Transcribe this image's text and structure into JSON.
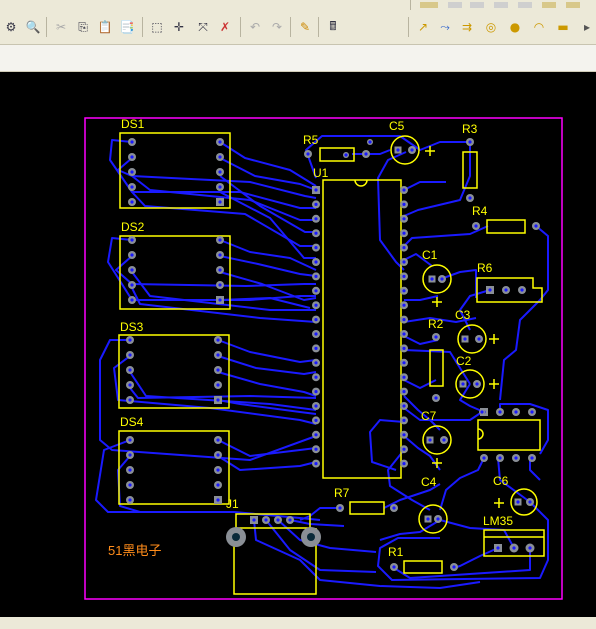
{
  "toolbar": {
    "left_tools": [
      "browse-icon",
      "zoom-icon",
      "cut-icon",
      "copy-icon",
      "paste-icon",
      "paste-special-icon",
      "select-icon",
      "move-icon",
      "cross-select-icon",
      "deselect-icon",
      "undo-icon",
      "redo-icon",
      "highlight-icon",
      "inspect-icon"
    ],
    "right_tools": [
      "route-icon",
      "interactive-route-icon",
      "diff-pair-icon",
      "via-icon",
      "pad-icon",
      "arc-icon",
      "fill-icon"
    ]
  },
  "board": {
    "outline_color": "#ff00ff",
    "silk_color": "#ffff00",
    "track_color": "#1a1aff",
    "pad_color": "#8a8f96",
    "brand_color": "#ff8c1a",
    "brand_text": "51黑电子",
    "designators": {
      "ds1": "DS1",
      "ds2": "DS2",
      "ds3": "DS3",
      "ds4": "DS4",
      "r5": "R5",
      "u1": "U1",
      "c5": "C5",
      "r3": "R3",
      "r4": "R4",
      "c1": "C1",
      "r6": "R6",
      "r2": "R2",
      "c3": "C3",
      "c2": "C2",
      "c7": "C7",
      "c4": "C4",
      "c6": "C6",
      "r7": "R7",
      "j1": "J1",
      "lm35": "LM35",
      "r1": "R1"
    },
    "polarity": "+"
  }
}
